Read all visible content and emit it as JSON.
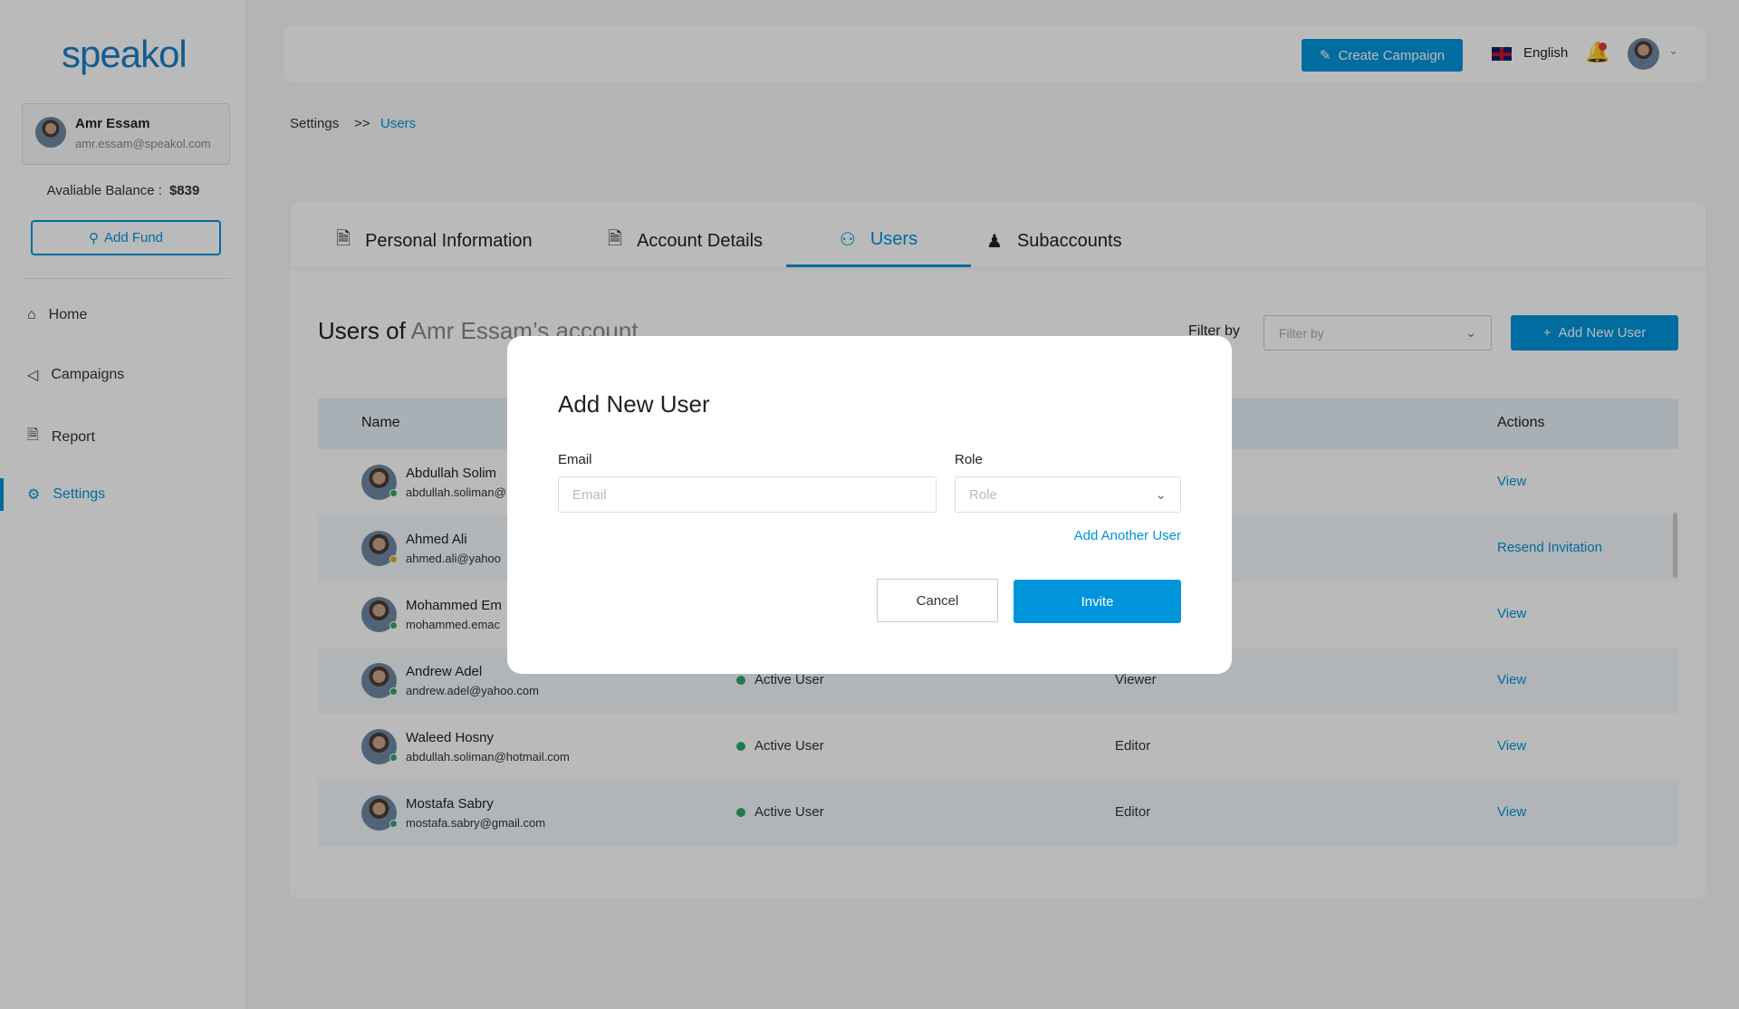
{
  "sidebar": {
    "logo": "speakol",
    "user_name": "Amr Essam",
    "user_email": "amr.essam@speakol.com",
    "balance_label": "Avaliable Balance :",
    "balance_value": "$839",
    "add_fund": "Add Fund",
    "nav": [
      {
        "label": "Home",
        "icon": "home-icon"
      },
      {
        "label": "Campaigns",
        "icon": "megaphone-icon"
      },
      {
        "label": "Report",
        "icon": "report-icon"
      },
      {
        "label": "Settings",
        "icon": "gear-icon",
        "active": true
      }
    ]
  },
  "header": {
    "create_campaign": "Create Campaign",
    "language": "English",
    "notification_badge": true
  },
  "breadcrumb": {
    "parent": "Settings",
    "separator": ">>",
    "current": "Users"
  },
  "tabs": [
    {
      "label": "Personal Information"
    },
    {
      "label": "Account Details"
    },
    {
      "label": "Users",
      "active": true
    },
    {
      "label": "Subaccounts"
    }
  ],
  "main": {
    "heading_prefix": "Users of",
    "heading_account": "Amr Essam’s account",
    "filter_label": "Filter by",
    "filter_placeholder": "Filter by",
    "add_user": "Add New User",
    "columns": {
      "name": "Name",
      "actions": "Actions"
    },
    "rows": [
      {
        "name": "Abdullah Solim",
        "email": "abdullah.soliman@",
        "status": "",
        "role": "",
        "action": "View",
        "presence": "#2ea86a"
      },
      {
        "name": "Ahmed Ali",
        "email": "ahmed.ali@yahoo",
        "status": "",
        "role": "",
        "action": "Resend Invitation",
        "presence": "#e0a92a"
      },
      {
        "name": "Mohammed Em",
        "email": "mohammed.emac",
        "status": "",
        "role": "",
        "action": "View",
        "presence": "#2ea86a"
      },
      {
        "name": "Andrew Adel",
        "email": "andrew.adel@yahoo.com",
        "status": "Active User",
        "role": "Viewer",
        "action": "View",
        "presence": "#2ea86a"
      },
      {
        "name": "Waleed Hosny",
        "email": "abdullah.soliman@hotmail.com",
        "status": "Active User",
        "role": "Editor",
        "action": "View",
        "presence": "#2ea86a"
      },
      {
        "name": "Mostafa Sabry",
        "email": "mostafa.sabry@gmail.com",
        "status": "Active User",
        "role": "Editor",
        "action": "View",
        "presence": "#2ea86a"
      }
    ]
  },
  "modal": {
    "title": "Add New User",
    "email_label": "Email",
    "email_placeholder": "Email",
    "role_label": "Role",
    "role_placeholder": "Role",
    "add_another": "Add Another User",
    "cancel": "Cancel",
    "invite": "Invite"
  },
  "colors": {
    "accent": "#0095da",
    "active_status": "#2ea86a",
    "pending_status": "#e0a92a",
    "notification": "#e53935"
  }
}
